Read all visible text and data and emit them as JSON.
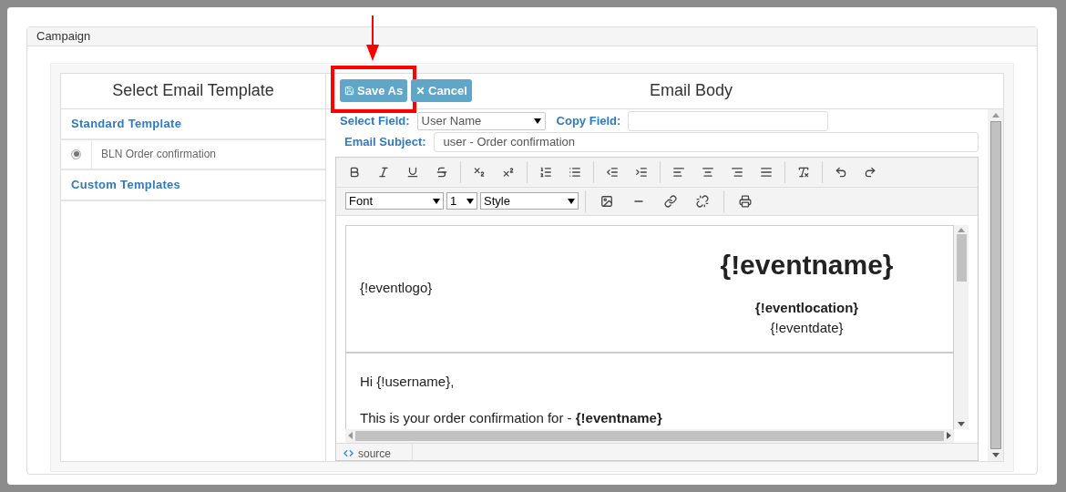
{
  "dialog": {
    "title": "Campaign"
  },
  "template_panel": {
    "title": "Select Email Template",
    "sections": [
      {
        "heading": "Standard Template",
        "items": [
          {
            "label": "BLN Order confirmation",
            "selected": true
          }
        ]
      },
      {
        "heading": "Custom Templates"
      }
    ]
  },
  "editor": {
    "title": "Email Body",
    "buttons": [
      {
        "label": "Save As",
        "kind": "save",
        "highlighted": true
      },
      {
        "label": "Cancel",
        "kind": "cancel",
        "highlighted": false
      }
    ],
    "select_field": {
      "label": "Select Field:",
      "value": "User Name"
    },
    "copy_field": {
      "label": "Copy Field:"
    },
    "subject": {
      "label": "Email Subject:",
      "value": "user - Order confirmation"
    },
    "font_selects": [
      {
        "value": "Font",
        "kind": "wide"
      },
      {
        "value": "1",
        "kind": "narrow"
      },
      {
        "value": "Style",
        "kind": "wide"
      }
    ],
    "content": {
      "logo": "{!eventlogo}",
      "event_name": "{!eventname}",
      "location": "{!eventlocation}",
      "date": "{!eventdate}",
      "greeting": "Hi {!username},",
      "line": "This is your order confirmation for - **{!eventname}**"
    },
    "source_tab": "source"
  }
}
